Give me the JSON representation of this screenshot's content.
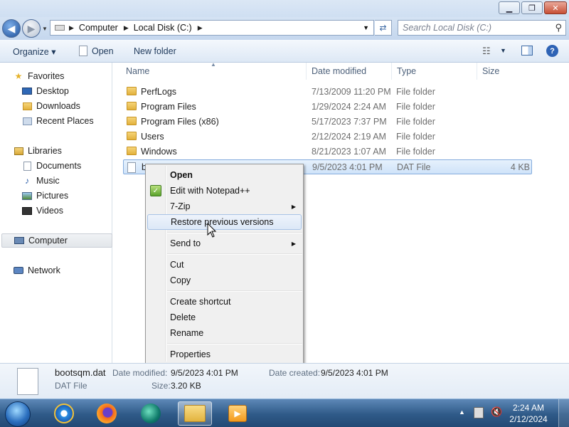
{
  "window": {
    "minimize_glyph": "▁",
    "maximize_glyph": "❐",
    "close_glyph": "✕"
  },
  "address": {
    "segments": [
      "Computer",
      "Local Disk (C:)"
    ],
    "search_placeholder": "Search Local Disk (C:)"
  },
  "toolbar": {
    "organize": "Organize ▾",
    "open": "Open",
    "new_folder": "New folder"
  },
  "sidebar": {
    "favorites": "Favorites",
    "desktop": "Desktop",
    "downloads": "Downloads",
    "recent_places": "Recent Places",
    "libraries": "Libraries",
    "documents": "Documents",
    "music": "Music",
    "pictures": "Pictures",
    "videos": "Videos",
    "computer": "Computer",
    "network": "Network"
  },
  "columns": {
    "name": "Name",
    "date_modified": "Date modified",
    "type": "Type",
    "size": "Size"
  },
  "files": [
    {
      "name": "PerfLogs",
      "date": "7/13/2009 11:20 PM",
      "type": "File folder",
      "size": ""
    },
    {
      "name": "Program Files",
      "date": "1/29/2024 2:24 AM",
      "type": "File folder",
      "size": ""
    },
    {
      "name": "Program Files (x86)",
      "date": "5/17/2023 7:37 PM",
      "type": "File folder",
      "size": ""
    },
    {
      "name": "Users",
      "date": "2/12/2024 2:19 AM",
      "type": "File folder",
      "size": ""
    },
    {
      "name": "Windows",
      "date": "8/21/2023 1:07 AM",
      "type": "File folder",
      "size": ""
    },
    {
      "name": "bootsqm.dat",
      "visible_name": "b",
      "date": "9/5/2023 4:01 PM",
      "type": "DAT File",
      "size": "4 KB"
    }
  ],
  "context_menu": {
    "open": "Open",
    "edit_notepad": "Edit with Notepad++",
    "seven_zip": "7-Zip",
    "restore": "Restore previous versions",
    "send_to": "Send to",
    "cut": "Cut",
    "copy": "Copy",
    "create_shortcut": "Create shortcut",
    "delete": "Delete",
    "rename": "Rename",
    "properties": "Properties"
  },
  "details": {
    "filename": "bootsqm.dat",
    "filetype": "DAT File",
    "date_modified_label": "Date modified:",
    "date_modified": "9/5/2023 4:01 PM",
    "date_created_label": "Date created:",
    "date_created": "9/5/2023 4:01 PM",
    "size_label": "Size:",
    "size": "3.20 KB"
  },
  "taskbar": {
    "time": "2:24 AM",
    "date": "2/12/2024"
  }
}
